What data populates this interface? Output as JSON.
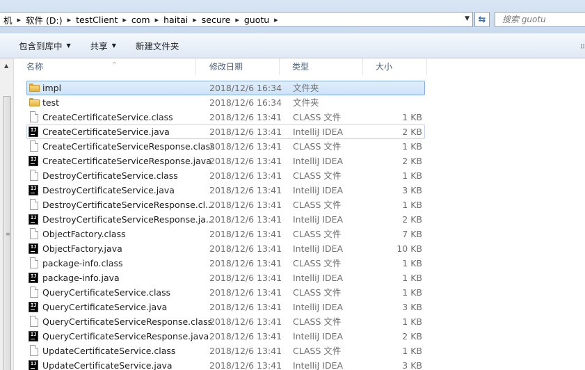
{
  "address_bar": {
    "crumbs": [
      "机",
      "软件 (D:)",
      "testClient",
      "com",
      "haitai",
      "secure",
      "guotu"
    ],
    "dropdown_icon": "chevron-down-icon",
    "refresh_icon": "refresh-icon"
  },
  "search": {
    "placeholder": "搜索 guotu"
  },
  "toolbar": {
    "include_library_label": "包含到库中",
    "share_label": "共享",
    "new_folder_label": "新建文件夹"
  },
  "columns": {
    "name": "名称",
    "date": "修改日期",
    "type": "类型",
    "size": "大小"
  },
  "files": [
    {
      "name": "impl",
      "date": "2018/12/6 16:34",
      "type": "文件夹",
      "size": "",
      "icon": "folder-icon"
    },
    {
      "name": "test",
      "date": "2018/12/6 16:34",
      "type": "文件夹",
      "size": "",
      "icon": "folder-icon"
    },
    {
      "name": "CreateCertificateService.class",
      "date": "2018/12/6 13:41",
      "type": "CLASS 文件",
      "size": "1 KB",
      "icon": "class-file-icon"
    },
    {
      "name": "CreateCertificateService.java",
      "date": "2018/12/6 13:41",
      "type": "IntelliJ IDEA",
      "size": "2 KB",
      "icon": "intellij-file-icon"
    },
    {
      "name": "CreateCertificateServiceResponse.class",
      "date": "2018/12/6 13:41",
      "type": "CLASS 文件",
      "size": "1 KB",
      "icon": "class-file-icon"
    },
    {
      "name": "CreateCertificateServiceResponse.java",
      "date": "2018/12/6 13:41",
      "type": "IntelliJ IDEA",
      "size": "2 KB",
      "icon": "intellij-file-icon"
    },
    {
      "name": "DestroyCertificateService.class",
      "date": "2018/12/6 13:41",
      "type": "CLASS 文件",
      "size": "1 KB",
      "icon": "class-file-icon"
    },
    {
      "name": "DestroyCertificateService.java",
      "date": "2018/12/6 13:41",
      "type": "IntelliJ IDEA",
      "size": "3 KB",
      "icon": "intellij-file-icon"
    },
    {
      "name": "DestroyCertificateServiceResponse.cl...",
      "date": "2018/12/6 13:41",
      "type": "CLASS 文件",
      "size": "1 KB",
      "icon": "class-file-icon"
    },
    {
      "name": "DestroyCertificateServiceResponse.ja...",
      "date": "2018/12/6 13:41",
      "type": "IntelliJ IDEA",
      "size": "2 KB",
      "icon": "intellij-file-icon"
    },
    {
      "name": "ObjectFactory.class",
      "date": "2018/12/6 13:41",
      "type": "CLASS 文件",
      "size": "7 KB",
      "icon": "class-file-icon"
    },
    {
      "name": "ObjectFactory.java",
      "date": "2018/12/6 13:41",
      "type": "IntelliJ IDEA",
      "size": "10 KB",
      "icon": "intellij-file-icon"
    },
    {
      "name": "package-info.class",
      "date": "2018/12/6 13:41",
      "type": "CLASS 文件",
      "size": "1 KB",
      "icon": "class-file-icon"
    },
    {
      "name": "package-info.java",
      "date": "2018/12/6 13:41",
      "type": "IntelliJ IDEA",
      "size": "1 KB",
      "icon": "intellij-file-icon"
    },
    {
      "name": "QueryCertificateService.class",
      "date": "2018/12/6 13:41",
      "type": "CLASS 文件",
      "size": "1 KB",
      "icon": "class-file-icon"
    },
    {
      "name": "QueryCertificateService.java",
      "date": "2018/12/6 13:41",
      "type": "IntelliJ IDEA",
      "size": "3 KB",
      "icon": "intellij-file-icon"
    },
    {
      "name": "QueryCertificateServiceResponse.class",
      "date": "2018/12/6 13:41",
      "type": "CLASS 文件",
      "size": "1 KB",
      "icon": "class-file-icon"
    },
    {
      "name": "QueryCertificateServiceResponse.java",
      "date": "2018/12/6 13:41",
      "type": "IntelliJ IDEA",
      "size": "2 KB",
      "icon": "intellij-file-icon"
    },
    {
      "name": "UpdateCertificateService.class",
      "date": "2018/12/6 13:41",
      "type": "CLASS 文件",
      "size": "1 KB",
      "icon": "class-file-icon"
    },
    {
      "name": "UpdateCertificateService.java",
      "date": "2018/12/6 13:41",
      "type": "IntelliJ IDEA",
      "size": "3 KB",
      "icon": "intellij-file-icon"
    }
  ],
  "selected_index": 0,
  "hover_index": 3
}
